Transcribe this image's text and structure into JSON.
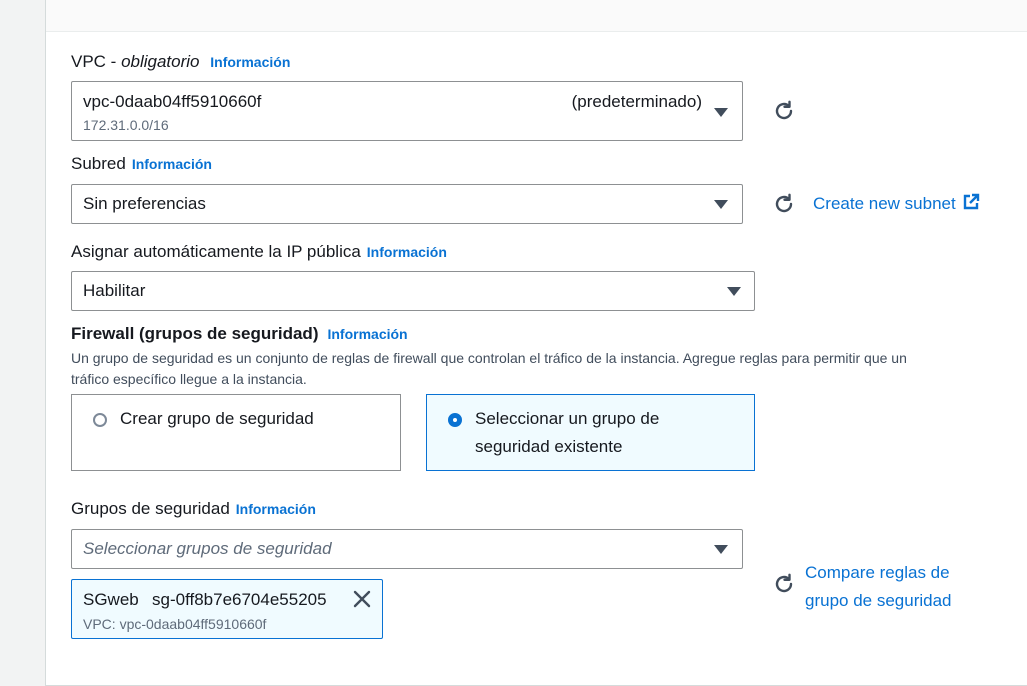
{
  "common": {
    "info_label": "Información"
  },
  "vpc": {
    "label": "VPC - ",
    "required": "obligatorio",
    "value": "vpc-0daab04ff5910660f",
    "tag": "(predeterminado)",
    "cidr": "172.31.0.0/16"
  },
  "subnet": {
    "label": "Subred",
    "value": "Sin preferencias",
    "create_link": "Create new subnet"
  },
  "public_ip": {
    "label": "Asignar automáticamente la IP pública",
    "value": "Habilitar"
  },
  "firewall": {
    "title": "Firewall (grupos de seguridad)",
    "description_line1": "Un grupo de seguridad es un conjunto de reglas de firewall que controlan el tráfico de la instancia. Agregue reglas para permitir que un",
    "description_line2": "tráfico específico llegue a la instancia.",
    "option_create": "Crear grupo de seguridad",
    "option_existing_line1": "Seleccionar un grupo de",
    "option_existing_line2": "seguridad existente",
    "selected_option": "existing"
  },
  "security_groups": {
    "label": "Grupos de seguridad",
    "placeholder": "Seleccionar grupos de seguridad",
    "compare_link_line1": "Compare reglas de",
    "compare_link_line2": "grupo de seguridad",
    "selected": [
      {
        "name": "SGweb",
        "id": "sg-0ff8b7e6704e55205",
        "vpc": "VPC: vpc-0daab04ff5910660f"
      }
    ]
  },
  "colors": {
    "link": "#0972d3",
    "selected_bg": "#f0fbff",
    "border": "#8d9092"
  }
}
